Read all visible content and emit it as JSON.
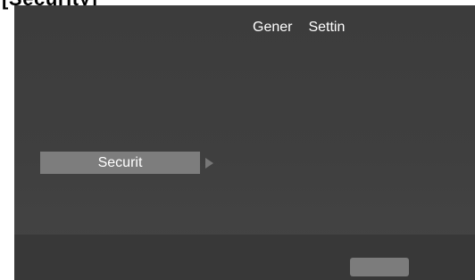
{
  "page": {
    "title": "[Security]"
  },
  "header": {
    "tabs": [
      "Gener",
      "Settin"
    ]
  },
  "menu": {
    "selected_item": "Securit"
  },
  "footer": {
    "button_label": ""
  },
  "icons": {
    "menu_arrow": "right-triangle"
  },
  "colors": {
    "background": "#3f3f3f",
    "selected_item": "#7d7d7d",
    "footer": "#383838",
    "text": "#ffffff"
  }
}
